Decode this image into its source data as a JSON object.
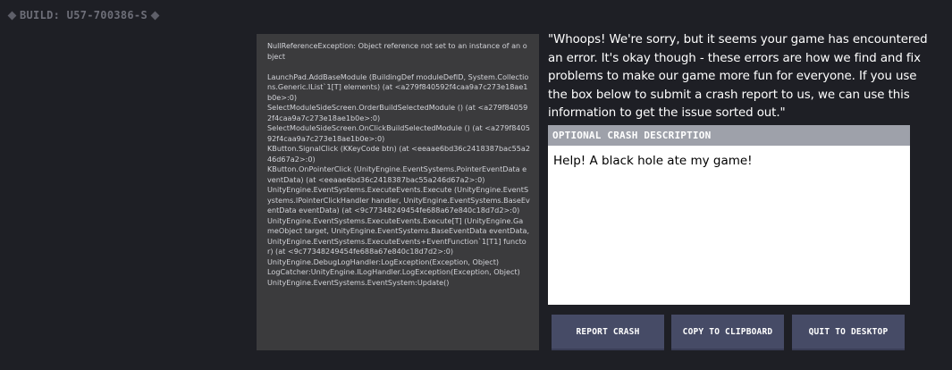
{
  "build": {
    "label": "BUILD: U57-700386-S",
    "left_icon": "diamond-icon",
    "right_icon": "diamond-icon"
  },
  "stack_trace": {
    "text": "NullReferenceException: Object reference not set to an instance of an object\n\nLaunchPad.AddBaseModule (BuildingDef moduleDefID, System.Collections.Generic.IList`1[T] elements) (at <a279f840592f4caa9a7c273e18ae1b0e>:0)\nSelectModuleSideScreen.OrderBuildSelectedModule () (at <a279f840592f4caa9a7c273e18ae1b0e>:0)\nSelectModuleSideScreen.OnClickBuildSelectedModule () (at <a279f840592f4caa9a7c273e18ae1b0e>:0)\nKButton.SignalClick (KKeyCode btn) (at <eeaae6bd36c2418387bac55a246d67a2>:0)\nKButton.OnPointerClick (UnityEngine.EventSystems.PointerEventData eventData) (at <eeaae6bd36c2418387bac55a246d67a2>:0)\nUnityEngine.EventSystems.ExecuteEvents.Execute (UnityEngine.EventSystems.IPointerClickHandler handler, UnityEngine.EventSystems.BaseEventData eventData) (at <9c77348249454fe688a67e840c18d7d2>:0)\nUnityEngine.EventSystems.ExecuteEvents.Execute[T] (UnityEngine.GameObject target, UnityEngine.EventSystems.BaseEventData eventData, UnityEngine.EventSystems.ExecuteEvents+EventFunction`1[T1] functor) (at <9c77348249454fe688a67e840c18d7d2>:0)\nUnityEngine.DebugLogHandler:LogException(Exception, Object)\nLogCatcher:UnityEngine.ILogHandler.LogException(Exception, Object)\nUnityEngine.EventSystems.EventSystem:Update()"
  },
  "message": "\"Whoops! We're sorry, but it seems your game has encountered an error. It's okay though - these errors are how we find and fix problems to make our game more fun for everyone. If you use the box below to submit a crash report to us, we can use this information to get the issue sorted out.\"",
  "crash_description": {
    "header": "OPTIONAL CRASH DESCRIPTION",
    "value": "Help! A black hole ate my game!"
  },
  "buttons": {
    "report": "REPORT CRASH",
    "copy": "COPY TO CLIPBOARD",
    "quit": "QUIT TO DESKTOP"
  },
  "colors": {
    "background": "#1e1f25",
    "panel": "#3b3b3d",
    "header_bar": "#9ea1aa",
    "button": "#464b66"
  }
}
